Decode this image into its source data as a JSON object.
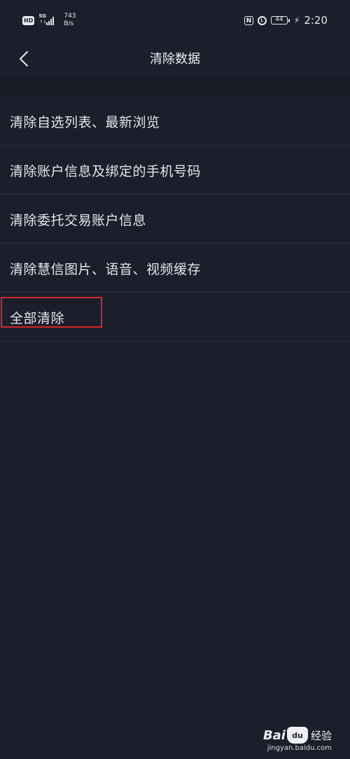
{
  "status_bar": {
    "hd": "HD",
    "network_gen": "5G",
    "network_arrows": "↑↓",
    "speed_value": "743",
    "speed_unit": "B/s",
    "nfc": "N",
    "battery_level": "44",
    "bolt": "⚡",
    "time": "2:20"
  },
  "header": {
    "title": "清除数据"
  },
  "items": [
    {
      "label": "清除自选列表、最新浏览"
    },
    {
      "label": "清除账户信息及绑定的手机号码"
    },
    {
      "label": "清除委托交易账户信息"
    },
    {
      "label": "清除慧信图片、语音、视频缓存"
    },
    {
      "label": "全部清除"
    }
  ],
  "colors": {
    "background": "#1c1f2b",
    "highlight": "#d9232a",
    "text": "#e4e6ec"
  },
  "icons": {
    "back": "back-chevron-icon",
    "alarm": "alarm-icon",
    "nfc": "nfc-icon",
    "battery": "battery-icon",
    "signal": "signal-icon"
  },
  "watermark": {
    "bai": "Bai",
    "du": "du",
    "jingyan": "经验",
    "url": "jingyan.baidu.com"
  }
}
